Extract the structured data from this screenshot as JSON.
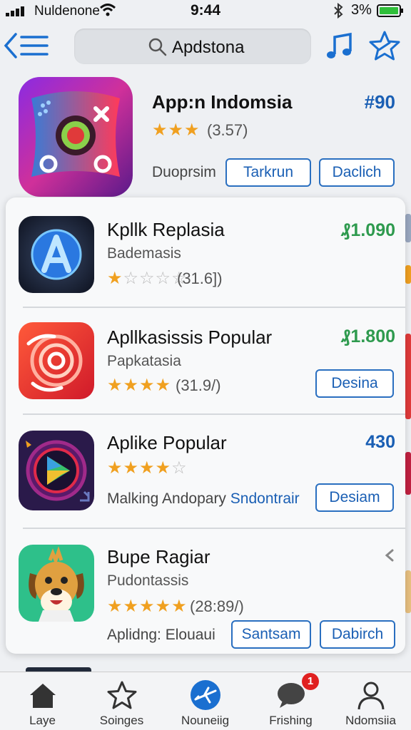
{
  "status_bar": {
    "carrier": "Nuldenone",
    "time": "9:44",
    "battery_pct": "3%"
  },
  "header": {
    "search_text": "Apdstona"
  },
  "featured": {
    "title": "App:n Indomsia",
    "price": "#90",
    "stars": "★★★",
    "rating": "(3.57)",
    "subtitle": "Duoprsim",
    "button_1": "Tarkrun",
    "button_2": "Daclich"
  },
  "apps": [
    {
      "title": "Kpllk Replasia",
      "price": "₰1.090",
      "subtitle": "Bademasis",
      "stars_filled": "★",
      "stars_empty": "☆☆☆☆",
      "rating": "(31.6])",
      "accent": "#2e9a4e"
    },
    {
      "title": "Apllkasissis Popular",
      "price": "₰1.800",
      "subtitle": "Papkatasia",
      "stars_filled": "★★★★",
      "stars_empty": "",
      "rating": "(31.9/)",
      "button": "Desina"
    },
    {
      "title": "Aplike Popular",
      "price": "430",
      "stars_filled": "★★★★",
      "stars_empty": "☆",
      "developer": "Malking Andopary",
      "developer_link": "Sndontrair",
      "button": "Desiam"
    },
    {
      "title": "Bupe Ragiar",
      "subtitle": "Pudontassis",
      "stars_filled": "★★★★★",
      "rating": "(28:89/)",
      "developer": "Aplidng: Elouaui",
      "button_1": "Santsam",
      "button_2": "Dabirch"
    }
  ],
  "tabs": [
    {
      "label": "Laye",
      "icon": "home-icon"
    },
    {
      "label": "Soinges",
      "icon": "star-icon"
    },
    {
      "label": "Nouneiig",
      "icon": "airplane-icon"
    },
    {
      "label": "Frishing",
      "icon": "chat-icon",
      "badge": "1"
    },
    {
      "label": "Ndomsiia",
      "icon": "profile-icon"
    }
  ],
  "colors": {
    "accent_blue": "#1a5fb4",
    "price_green": "#2e9a4e",
    "star_gold": "#f0a020",
    "badge_red": "#e02020"
  }
}
